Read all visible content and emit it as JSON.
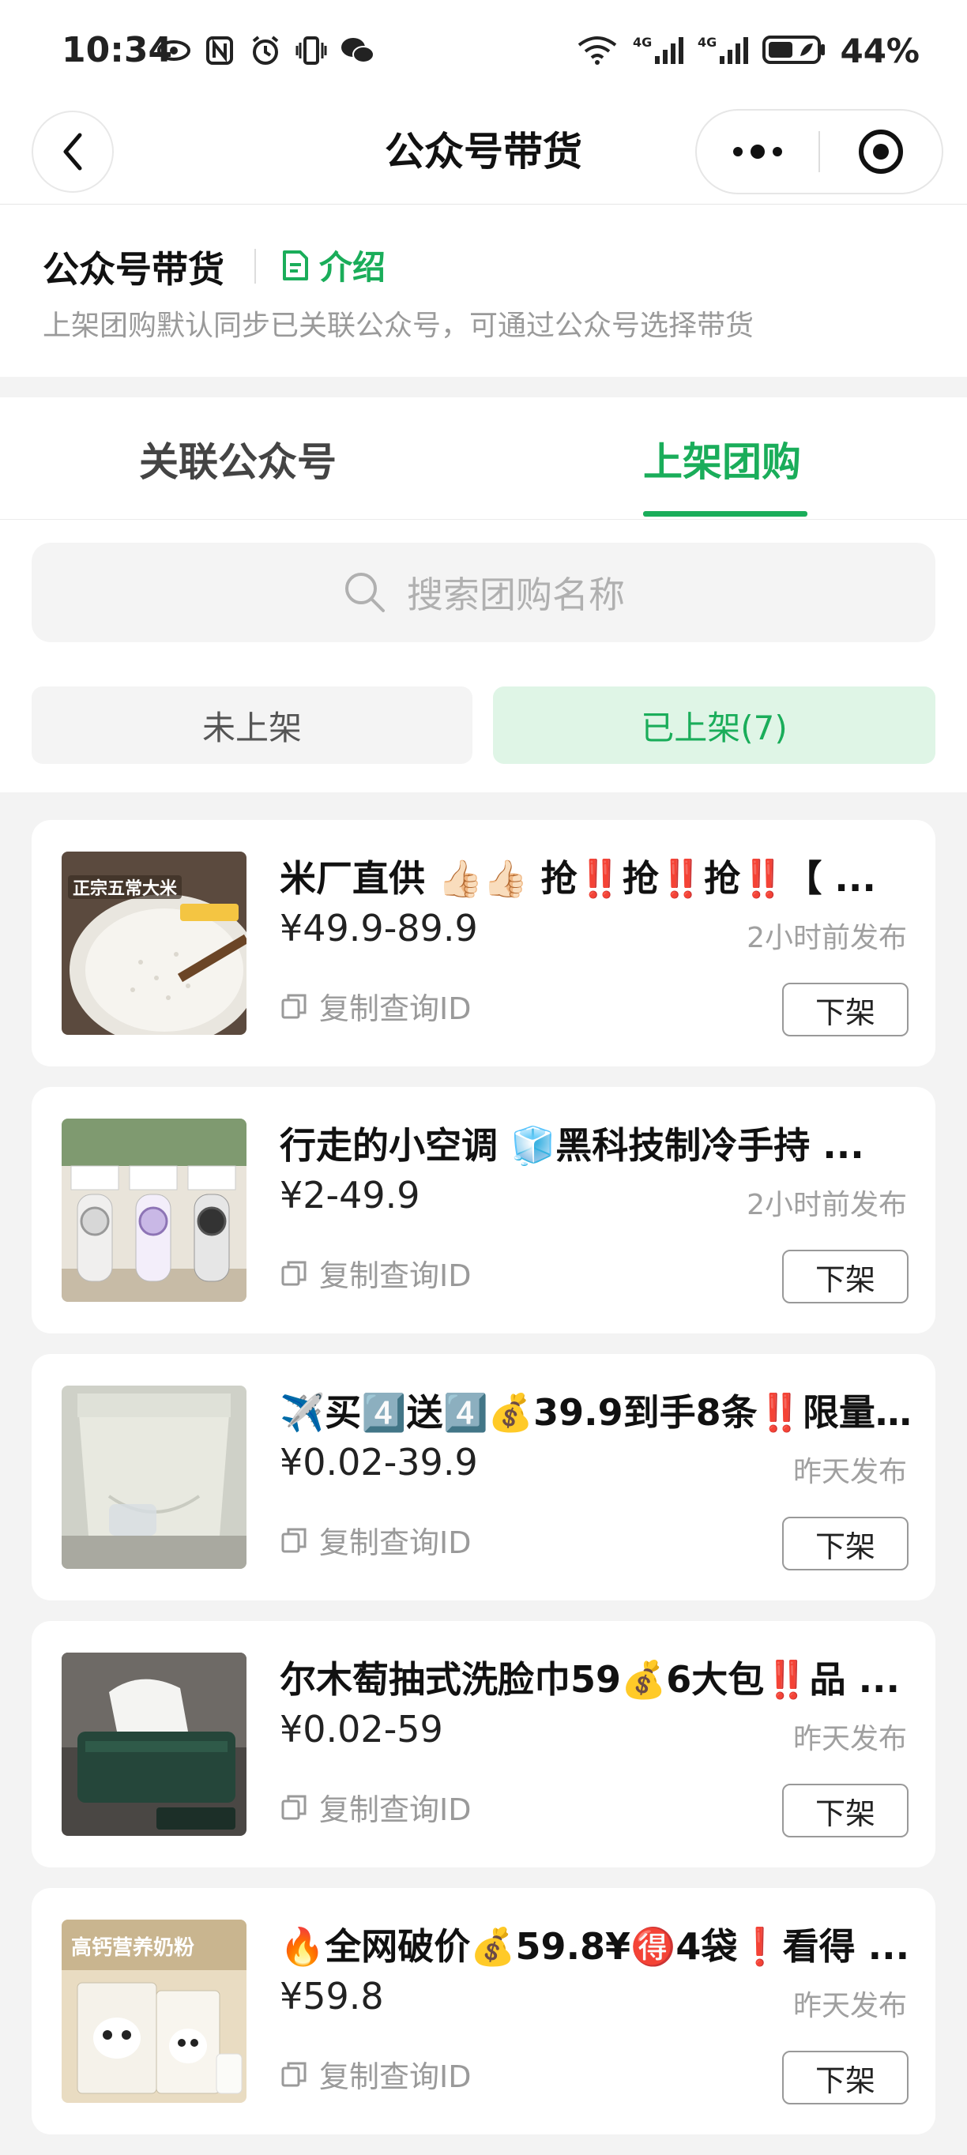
{
  "status_bar": {
    "time": "10:34",
    "battery": "44%",
    "icons": [
      "eye-icon",
      "nfc-icon",
      "alarm-icon",
      "vibrate-icon",
      "wechat-icon",
      "wifi-icon",
      "signal-4g-icon",
      "signal-4g-icon",
      "battery-icon"
    ]
  },
  "nav": {
    "title": "公众号带货"
  },
  "header": {
    "title": "公众号带货",
    "intro_label": "介绍",
    "description": "上架团购默认同步已关联公众号，可通过公众号选择带货"
  },
  "tabs": [
    {
      "label": "关联公众号",
      "active": false
    },
    {
      "label": "上架团购",
      "active": true
    }
  ],
  "search": {
    "placeholder": "搜索团购名称"
  },
  "segments": [
    {
      "label": "未上架",
      "active": false
    },
    {
      "label": "已上架(7)",
      "active": true
    }
  ],
  "items": [
    {
      "title": "米厂直供 👍🏻👍🏻 抢‼️抢‼️抢‼️【 ...",
      "price": "¥49.9-89.9",
      "time": "2小时前发布",
      "copy_label": "复制查询ID",
      "button": "下架",
      "thumb_text": "正宗五常大米"
    },
    {
      "title": "行走的小空调 🧊黑科技制冷手持 ...",
      "price": "¥2-49.9",
      "time": "2小时前发布",
      "copy_label": "复制查询ID",
      "button": "下架",
      "thumb_text": ""
    },
    {
      "title": "✈️买4️⃣送4️⃣💰39.9到手8条‼️限量 ...",
      "price": "¥0.02-39.9",
      "time": "昨天发布",
      "copy_label": "复制查询ID",
      "button": "下架",
      "thumb_text": ""
    },
    {
      "title": "尔木萄抽式洗脸巾59💰6大包‼️品 ...",
      "price": "¥0.02-59",
      "time": "昨天发布",
      "copy_label": "复制查询ID",
      "button": "下架",
      "thumb_text": ""
    },
    {
      "title": "🔥全网破价💰59.8¥🉐4袋❗看得 ...",
      "price": "¥59.8",
      "time": "昨天发布",
      "copy_label": "复制查询ID",
      "button": "下架",
      "thumb_text": "高钙营养奶粉"
    }
  ],
  "colors": {
    "accent": "#1aad5a",
    "accent_bg": "#dff5e6",
    "muted": "#9a9a9a"
  }
}
